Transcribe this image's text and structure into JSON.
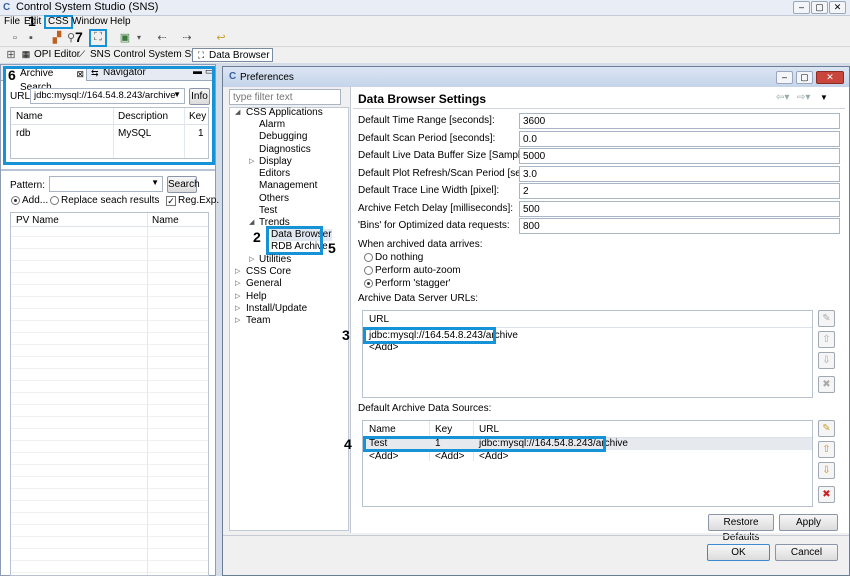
{
  "window": {
    "title": "Control System Studio (SNS)",
    "min": "–",
    "max": "▢",
    "close": "✕"
  },
  "menubar": {
    "items": [
      "File",
      "Edit",
      "CSS",
      "Window",
      "Help"
    ]
  },
  "perspectives": [
    {
      "label": "OPI Editor",
      "icon": "opi-editor-icon"
    },
    {
      "label": "SNS Control System Studio",
      "icon": "sns-css-icon"
    },
    {
      "label": "Data Browser",
      "icon": "data-browser-icon"
    }
  ],
  "callouts": {
    "c1": "1",
    "c2": "2",
    "c3": "3",
    "c4": "4",
    "c5": "5",
    "c6": "6",
    "c7": "7"
  },
  "left_view": {
    "tabs": [
      "Archive Search",
      "Navigator"
    ],
    "url_label": "URL:",
    "url_value": "jdbc:mysql://164.54.8.243/archive",
    "info_button": "Info",
    "archive_table": {
      "columns": [
        "Name",
        "Description",
        "Key"
      ],
      "rows": [
        {
          "name": "rdb",
          "description": "MySQL",
          "key": "1"
        }
      ]
    },
    "pattern_label": "Pattern:",
    "search_button": "Search",
    "add_option": "Add...",
    "replace_option": "Replace seach results",
    "regexp_label": "Reg.Exp.",
    "results_columns": [
      "PV Name",
      "Name"
    ]
  },
  "dialog": {
    "title": "Preferences",
    "filter_placeholder": "type filter text",
    "page_title": "Data Browser Settings",
    "tree": {
      "css_apps": "CSS Applications",
      "alarm": "Alarm",
      "debugging": "Debugging",
      "diagnostics": "Diagnostics",
      "display": "Display",
      "editors": "Editors",
      "management": "Management",
      "others": "Others",
      "test": "Test",
      "trends": "Trends",
      "data_browser": "Data Browser",
      "rdb_archive": "RDB Archive",
      "utilities": "Utilities",
      "css_core": "CSS Core",
      "general": "General",
      "help": "Help",
      "install_update": "Install/Update",
      "team": "Team"
    },
    "settings": [
      {
        "label": "Default Time Range [seconds]:",
        "value": "3600"
      },
      {
        "label": "Default Scan Period [seconds]:",
        "value": "0.0"
      },
      {
        "label": "Default Live Data Buffer Size [Samples]:",
        "value": "5000"
      },
      {
        "label": "Default Plot Refresh/Scan Period [seconds]:",
        "value": "3.0"
      },
      {
        "label": "Default Trace Line Width [pixel]:",
        "value": "2"
      },
      {
        "label": "Archive Fetch Delay [milliseconds]:",
        "value": "500"
      },
      {
        "label": "'Bins' for Optimized data requests:",
        "value": "800"
      }
    ],
    "archived_label": "When archived data arrives:",
    "radio_options": [
      "Do nothing",
      "Perform auto-zoom",
      "Perform 'stagger'"
    ],
    "server_urls_label": "Archive Data Server URLs:",
    "server_urls_column": "URL",
    "server_urls": [
      "jdbc:mysql://164.54.8.243/archive",
      "<Add>"
    ],
    "sources_label": "Default Archive Data Sources:",
    "sources_columns": [
      "Name",
      "Key",
      "URL"
    ],
    "sources_rows": [
      {
        "name": "Test",
        "key": "1",
        "url": "jdbc:mysql://164.54.8.243/archive"
      },
      {
        "name": "<Add>",
        "key": "<Add>",
        "url": "<Add>"
      }
    ],
    "restore_defaults": "Restore Defaults",
    "apply": "Apply",
    "ok": "OK",
    "cancel": "Cancel"
  }
}
